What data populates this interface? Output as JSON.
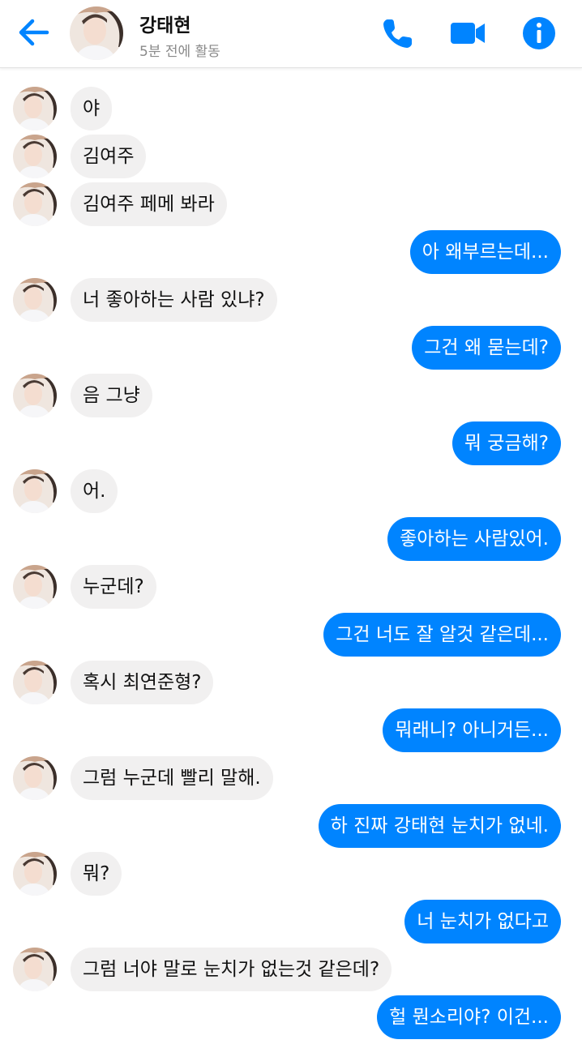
{
  "header": {
    "contact_name": "강태현",
    "status": "5분 전에 활동",
    "icons": {
      "back": "back-arrow-icon",
      "call": "phone-icon",
      "video": "video-camera-icon",
      "info": "info-icon"
    },
    "accent_color": "#0084ff"
  },
  "messages": [
    {
      "from": "them",
      "text": "야"
    },
    {
      "from": "them",
      "text": "김여주"
    },
    {
      "from": "them",
      "text": "김여주 페메 봐라"
    },
    {
      "from": "me",
      "text": "아 왜부르는데..."
    },
    {
      "from": "them",
      "text": "너 좋아하는 사람 있냐?"
    },
    {
      "from": "me",
      "text": "그건 왜 묻는데?"
    },
    {
      "from": "them",
      "text": "음 그냥"
    },
    {
      "from": "me",
      "text": "뭐 궁금해?"
    },
    {
      "from": "them",
      "text": "어."
    },
    {
      "from": "me",
      "text": "좋아하는 사람있어."
    },
    {
      "from": "them",
      "text": "누군데?"
    },
    {
      "from": "me",
      "text": "그건 너도 잘 알것 같은데..."
    },
    {
      "from": "them",
      "text": "혹시 최연준형?"
    },
    {
      "from": "me",
      "text": "뭐래니? 아니거든..."
    },
    {
      "from": "them",
      "text": "그럼 누군데 빨리 말해."
    },
    {
      "from": "me",
      "text": "하 진짜 강태현 눈치가 없네."
    },
    {
      "from": "them",
      "text": "뭐?"
    },
    {
      "from": "me",
      "text": "너 눈치가 없다고"
    },
    {
      "from": "them",
      "text": "그럼 너야 말로 눈치가 없는것 같은데?"
    },
    {
      "from": "me",
      "text": "헐 뭔소리야? 이건..."
    }
  ],
  "colors": {
    "incoming_bubble": "#f1f0f0",
    "outgoing_bubble": "#0084ff"
  }
}
